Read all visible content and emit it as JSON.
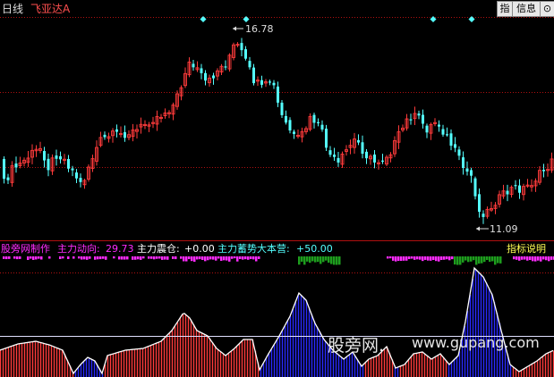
{
  "header": {
    "period": "日线",
    "stock_name": "飞亚达A"
  },
  "toolbar": {
    "btn1": "指",
    "btn2": "信息",
    "btn3": "⊙"
  },
  "price_annotations": {
    "high": "16.78",
    "low": "11.09"
  },
  "indicator": {
    "title": "股旁网制作",
    "line1_label": "主力动向:",
    "line1_value": "29.73",
    "line2_label": "主力震仓:",
    "line2_value": "+0.00",
    "line3_label": "主力蓄势大本营:",
    "line3_value": "+50.00",
    "help_button": "指标说明"
  },
  "watermark": {
    "cn": "股旁网.",
    "url": "www.gupang.com"
  },
  "colors": {
    "up": "#ff3b3b",
    "down": "#54ffff",
    "blue_fill": "#1a1acc",
    "green": "#1e9e1e",
    "magenta": "#ff2bff",
    "grid": "#b01010",
    "accent_yellow": "#ffff54"
  }
}
